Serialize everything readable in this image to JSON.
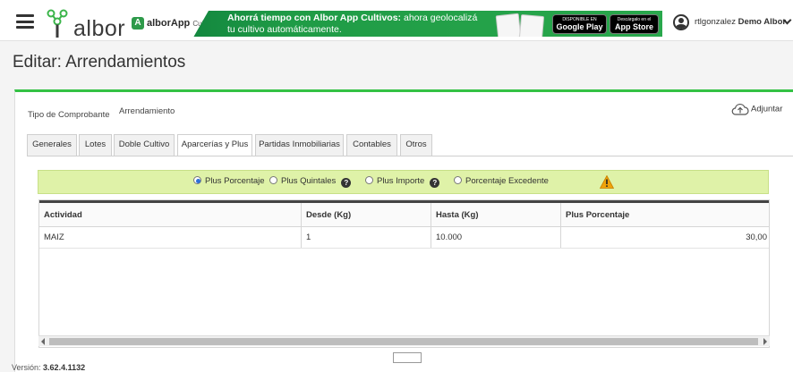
{
  "topbar": {
    "logo_text": "albor",
    "banner": {
      "app_name": "alborApp",
      "app_sub": "Cultivos",
      "headline_bold": "Ahorrá tiempo con Albor App Cultivos:",
      "headline_rest": " ahora geolocalizá tu cultivo automáticamente.",
      "google_play_small": "DISPONIBLE EN",
      "google_play": "Google Play",
      "app_store_small": "Descárgalo en el",
      "app_store": "App Store"
    },
    "user": {
      "login": "rtlgonzalez",
      "company": "Demo Albor"
    }
  },
  "page": {
    "title": "Editar: Arrendamientos"
  },
  "form": {
    "tipo_label": "Tipo de Comprobante",
    "tipo_value": "Arrendamiento",
    "adjuntar": "Adjuntar"
  },
  "tabs": [
    {
      "label": "Generales"
    },
    {
      "label": "Lotes"
    },
    {
      "label": "Doble Cultivo"
    },
    {
      "label": "Aparcerías y Plus"
    },
    {
      "label": "Partidas Inmobiliarias"
    },
    {
      "label": "Contables"
    },
    {
      "label": "Otros"
    }
  ],
  "active_tab": "Aparcerías y Plus",
  "options": {
    "plus_porcentaje": "Plus Porcentaje",
    "plus_quintales": "Plus Quintales",
    "plus_importe": "Plus Importe",
    "porcentaje_excedente": "Porcentaje Excedente",
    "selected": "Plus Porcentaje",
    "help_glyph": "?"
  },
  "grid": {
    "columns": [
      "Actividad",
      "Desde (Kg)",
      "Hasta (Kg)",
      "Plus Porcentaje"
    ],
    "rows": [
      [
        "MAIZ",
        "1",
        "10.000",
        "30,00"
      ]
    ]
  },
  "footer": {
    "version_label": "Versión:",
    "version": "3.62.4.1132"
  },
  "colors": {
    "accent_green": "#34c244",
    "options_bg": "#dff2a8",
    "warning": "#f0a30a"
  }
}
